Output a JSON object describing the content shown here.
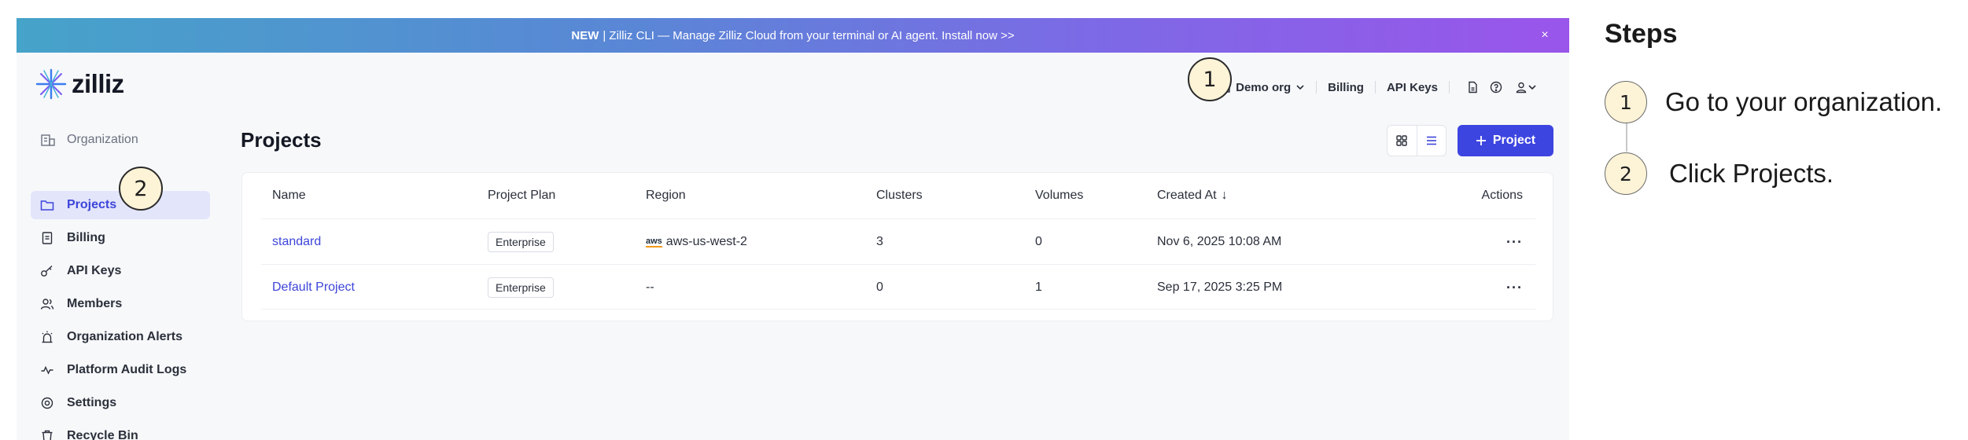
{
  "banner": {
    "new_label": "NEW",
    "text": "| Zilliz CLI — Manage Zilliz Cloud from your terminal or AI agent. Install now >>",
    "close_glyph": "×"
  },
  "brand": {
    "name": "zilliz",
    "logo_icon": "zilliz-star-logo"
  },
  "topnav": {
    "org_name": "Demo org",
    "billing": "Billing",
    "api_keys": "API Keys",
    "icons": [
      "document-icon",
      "help-icon",
      "user-icon"
    ]
  },
  "sidebar": {
    "section_label": "Organization",
    "items": [
      {
        "label": "Projects",
        "icon": "folder-icon",
        "active": true
      },
      {
        "label": "Billing",
        "icon": "receipt-icon"
      },
      {
        "label": "API Keys",
        "icon": "key-icon"
      },
      {
        "label": "Members",
        "icon": "members-icon"
      },
      {
        "label": "Organization Alerts",
        "icon": "alarm-icon"
      },
      {
        "label": "Platform Audit Logs",
        "icon": "pulse-icon"
      },
      {
        "label": "Settings",
        "icon": "gear-icon"
      },
      {
        "label": "Recycle Bin",
        "icon": "trash-icon"
      }
    ]
  },
  "main": {
    "title": "Projects",
    "new_project_button": "Project"
  },
  "table": {
    "columns": [
      "Name",
      "Project Plan",
      "Region",
      "Clusters",
      "Volumes",
      "Created At",
      "Actions"
    ],
    "sort_indicator": "↓",
    "rows": [
      {
        "name": "standard",
        "plan": "Enterprise",
        "region_prefix": "aws",
        "region": "aws-us-west-2",
        "clusters": "3",
        "volumes": "0",
        "created_at": "Nov 6, 2025 10:08 AM",
        "actions": "···"
      },
      {
        "name": "Default Project",
        "plan": "Enterprise",
        "region_prefix": "",
        "region": "--",
        "clusters": "0",
        "volumes": "1",
        "created_at": "Sep 17, 2025 3:25 PM",
        "actions": "···"
      }
    ]
  },
  "callouts": [
    "1",
    "2"
  ],
  "steps": {
    "title": "Steps",
    "items": [
      {
        "number": "1",
        "text": "Go to your organization."
      },
      {
        "number": "2",
        "text": "Click Projects."
      }
    ]
  },
  "colors": {
    "accent": "#3d45e0",
    "active_nav_bg": "#e3e5fb",
    "callout_fill": "#fdf3d7"
  }
}
